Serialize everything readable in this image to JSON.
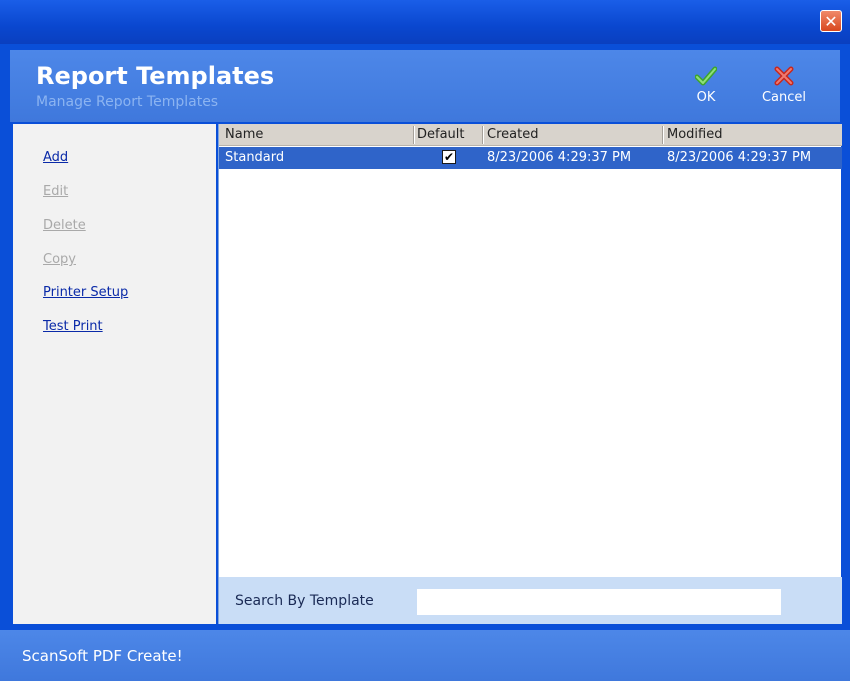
{
  "window": {
    "close_icon": "close-icon",
    "accent_color": "#0a4fd8"
  },
  "header": {
    "title": "Report Templates",
    "subtitle": "Manage Report Templates",
    "ok_label": "OK",
    "cancel_label": "Cancel",
    "ok_icon": "checkmark-icon",
    "cancel_icon": "x-mark-icon"
  },
  "sidebar": {
    "items": [
      {
        "label": "Add",
        "enabled": true
      },
      {
        "label": "Edit",
        "enabled": false
      },
      {
        "label": "Delete",
        "enabled": false
      },
      {
        "label": "Copy",
        "enabled": false
      },
      {
        "label": "Printer Setup",
        "enabled": true
      },
      {
        "label": "Test Print",
        "enabled": true
      }
    ]
  },
  "grid": {
    "columns": [
      "Name",
      "Default",
      "Created",
      "Modified"
    ],
    "rows": [
      {
        "name": "Standard",
        "default": true,
        "created": "8/23/2006 4:29:37 PM",
        "modified": "8/23/2006 4:29:37 PM"
      }
    ]
  },
  "search": {
    "label": "Search By Template",
    "value": ""
  },
  "footer": {
    "text": "ScanSoft PDF Create!"
  }
}
